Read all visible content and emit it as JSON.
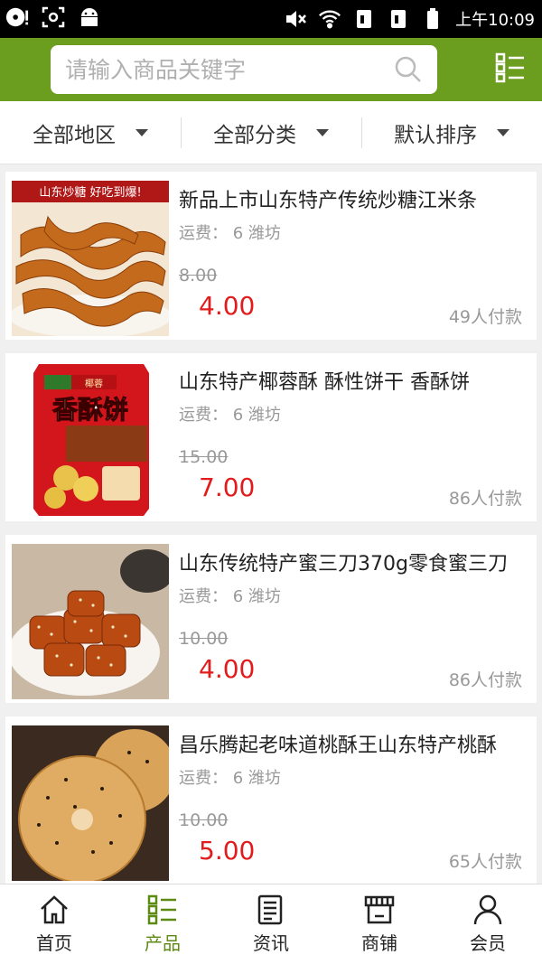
{
  "status_bar": {
    "time": "上午10:09",
    "icons": [
      "cd-icon",
      "screenshot-icon",
      "android-icon",
      "mute-icon",
      "wifi-icon",
      "sim1-icon",
      "sim2-icon",
      "battery-icon"
    ]
  },
  "search": {
    "placeholder": "请输入商品关键字",
    "value": ""
  },
  "filters": [
    {
      "label": "全部地区"
    },
    {
      "label": "全部分类"
    },
    {
      "label": "默认排序"
    }
  ],
  "products": [
    {
      "title": "新品上市山东特产传统炒糖江米条",
      "shipping_label": "运费：",
      "shipping_value": "6",
      "city": "潍坊",
      "old_price": "8.00",
      "price": "4.00",
      "paid": "49人付款",
      "image_caption": "山东炒糖  好吃到爆!"
    },
    {
      "title": "山东特产椰蓉酥 酥性饼干 香酥饼",
      "shipping_label": "运费：",
      "shipping_value": "6",
      "city": "潍坊",
      "old_price": "15.00",
      "price": "7.00",
      "paid": "86人付款",
      "image_caption": "香酥饼"
    },
    {
      "title": "山东传统特产蜜三刀370g零食蜜三刀",
      "shipping_label": "运费：",
      "shipping_value": "6",
      "city": "潍坊",
      "old_price": "10.00",
      "price": "4.00",
      "paid": "86人付款",
      "image_caption": ""
    },
    {
      "title": "昌乐腾起老味道桃酥王山东特产桃酥",
      "shipping_label": "运费：",
      "shipping_value": "6",
      "city": "潍坊",
      "old_price": "10.00",
      "price": "5.00",
      "paid": "65人付款",
      "image_caption": ""
    }
  ],
  "bottom_nav": [
    {
      "label": "首页",
      "icon": "home-icon",
      "active": false
    },
    {
      "label": "产品",
      "icon": "products-grid-icon",
      "active": true
    },
    {
      "label": "资讯",
      "icon": "news-icon",
      "active": false
    },
    {
      "label": "商铺",
      "icon": "store-icon",
      "active": false
    },
    {
      "label": "会员",
      "icon": "member-icon",
      "active": false
    }
  ],
  "colors": {
    "header": "#6b9e1f",
    "price_red": "#e21c1c",
    "nav_active": "#5c8a12"
  }
}
